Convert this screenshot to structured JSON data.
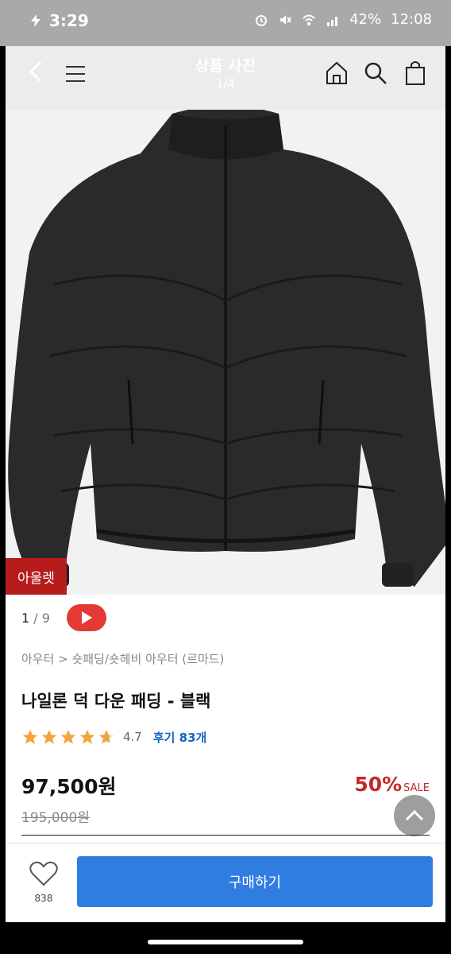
{
  "status_bar": {
    "time": "3:29",
    "battery": "42%",
    "clock_right": "12:08"
  },
  "gallery_header": {
    "title": "상품 사진",
    "counter": "1/4",
    "icons": [
      "back-icon",
      "menu-icon",
      "home-icon",
      "search-icon",
      "shopping-bag-icon"
    ]
  },
  "badge": {
    "label": "아울렛"
  },
  "media": {
    "current": "1",
    "total": "9"
  },
  "product": {
    "breadcrumb": "아우터 > 숏패딩/숏헤비 아우터 (르마드)",
    "name": "나일론 덕 다운 패딩 - 블랙",
    "rating_value": "4.7",
    "rating": 4.7,
    "reviews": "후기 83개",
    "price": "97,500원",
    "discount_rate": "50%",
    "sale_label": "SALE",
    "original_price": "195,000원"
  },
  "bottom": {
    "like_count": "838",
    "buy_label": "구매하기"
  },
  "colors": {
    "badge": "#b71c1c",
    "discount": "#c62828",
    "review_link": "#1565c0",
    "buy_button": "#2f7de1",
    "star": "#f2a33a"
  }
}
